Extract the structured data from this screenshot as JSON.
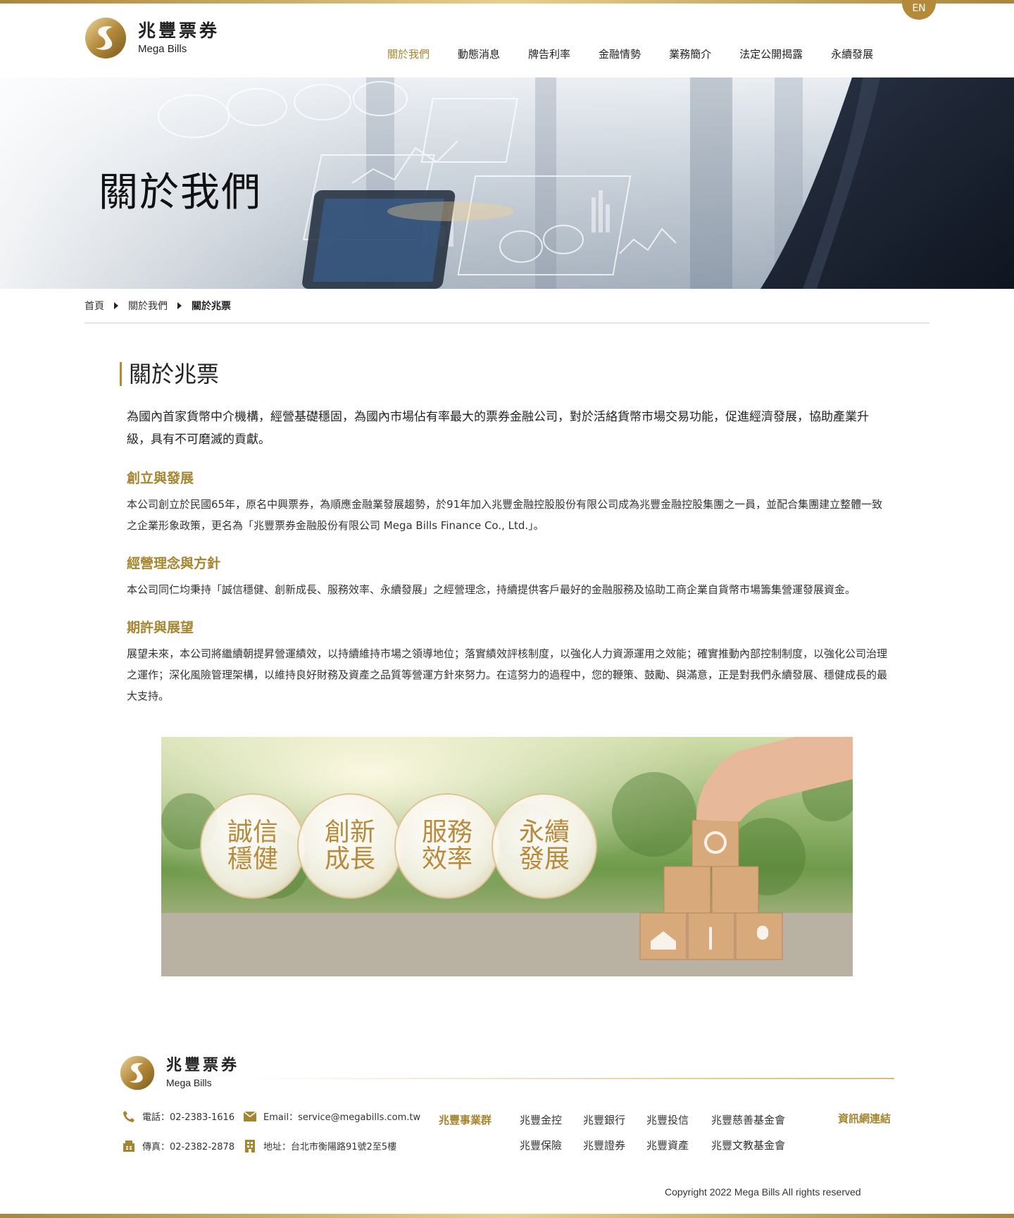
{
  "brand": {
    "name_cn": "兆豐票券",
    "name_en": "Mega Bills",
    "accent": "#a6852f"
  },
  "lang_toggle": "EN",
  "nav": [
    {
      "label": "關於我們",
      "active": true
    },
    {
      "label": "動態消息"
    },
    {
      "label": "牌告利率"
    },
    {
      "label": "金融情勢"
    },
    {
      "label": "業務簡介"
    },
    {
      "label": "法定公開揭露"
    },
    {
      "label": "永續發展"
    }
  ],
  "hero": {
    "title": "關於我們"
  },
  "breadcrumb": [
    "首頁",
    "關於我們",
    "關於兆票"
  ],
  "section": {
    "title": "關於兆票",
    "intro": "為國內首家貨幣中介機構，經營基礎穩固，為國內市場佔有率最大的票券金融公司，對於活絡貨幣市場交易功能，促進經濟發展，協助產業升級，具有不可磨滅的貢獻。",
    "blocks": [
      {
        "heading": "創立與發展",
        "text": "本公司創立於民國65年，原名中興票券，為順應金融業發展趨勢，於91年加入兆豐金融控股股份有限公司成為兆豐金融控股集團之一員，並配合集團建立整體一致之企業形象政策，更名為「兆豐票券金融股份有限公司 Mega Bills Finance Co., Ltd.」。"
      },
      {
        "heading": "經營理念與方針",
        "text": "本公司同仁均秉持「誠信穩健、創新成長、服務效率、永續發展」之經營理念，持續提供客戶最好的金融服務及協助工商企業自貨幣市場籌集營運發展資金。"
      },
      {
        "heading": "期許與展望",
        "text": "展望未來，本公司將繼續朝提昇營運績效，以持續維持市場之領導地位；落實績效評核制度，以強化人力資源運用之效能；確實推動內部控制制度，以強化公司治理之運作；深化風險管理架構，以維持良好財務及資產之品質等營運方針來努力。在這努力的過程中，您的鞭策、鼓勵、與滿意，正是對我們永續發展、穩健成長的最大支持。"
      }
    ]
  },
  "values": [
    {
      "line1": "誠信",
      "line2": "穩健"
    },
    {
      "line1": "創新",
      "line2": "成長"
    },
    {
      "line1": "服務",
      "line2": "效率"
    },
    {
      "line1": "永續",
      "line2": "發展"
    }
  ],
  "footer": {
    "phone": "電話：02-2383-1616",
    "fax": "傳真：02-2382-2878",
    "email": "Email：service@megabills.com.tw",
    "address": "地址：台北市衡陽路91號2至5樓",
    "group_label": "兆豐事業群",
    "group_links": [
      "兆豐金控",
      "兆豐銀行",
      "兆豐投信",
      "兆豐慈善基金會",
      "兆豐保險",
      "兆豐證券",
      "兆豐資產",
      "兆豐文教基金會"
    ],
    "info_link": "資訊網連結",
    "copyright": "Copyright 2022 Mega Bills All rights reserved"
  }
}
